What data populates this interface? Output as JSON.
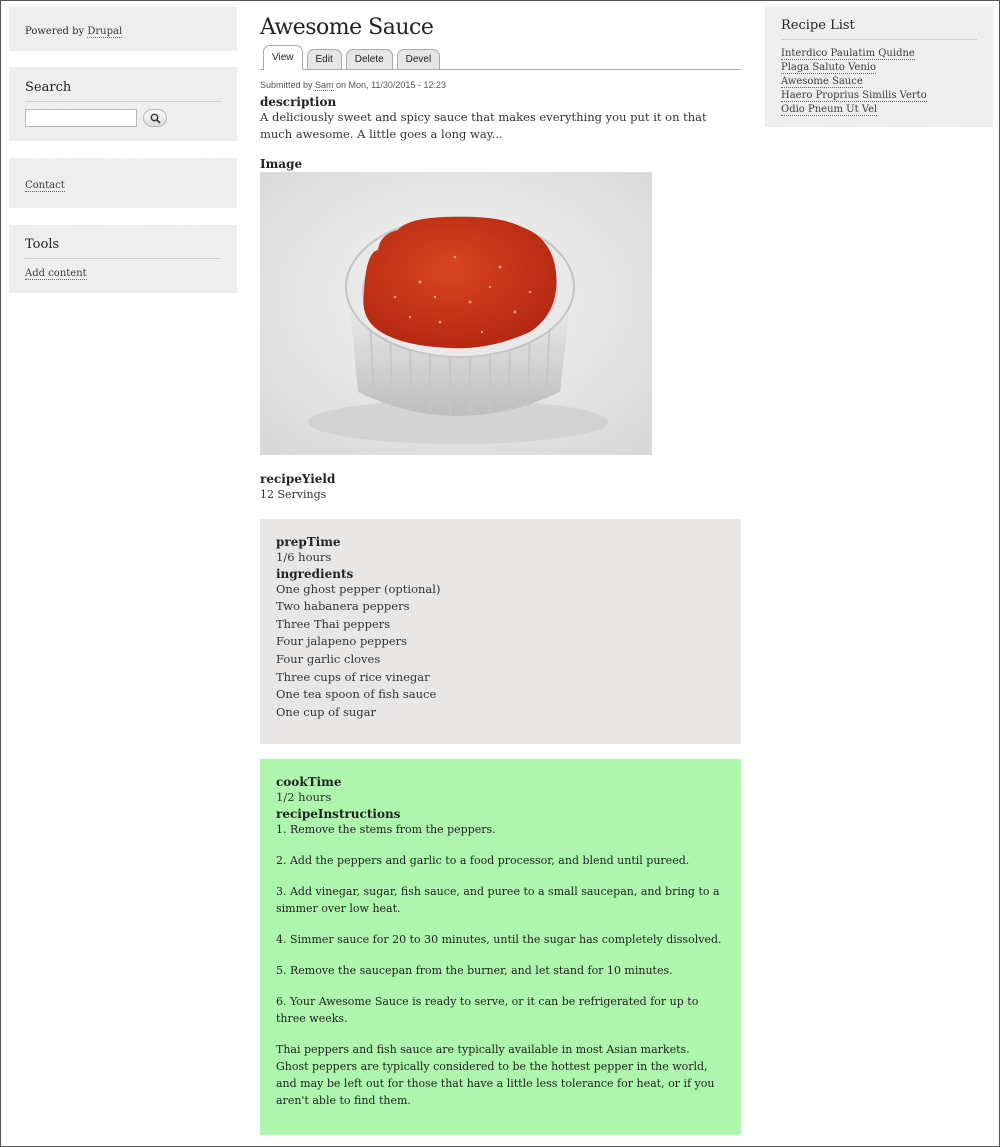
{
  "sidebar": {
    "powered_by_prefix": "Powered by ",
    "powered_by_link": "Drupal",
    "search": {
      "title": "Search",
      "value": "",
      "placeholder": ""
    },
    "contact_link": "Contact",
    "tools": {
      "title": "Tools",
      "add_content": "Add content"
    }
  },
  "recipe_list": {
    "title": "Recipe List",
    "items": [
      "Interdico Paulatim Quidne",
      "Plaga Saluto Venio",
      "Awesome Sauce",
      "Haero Proprius Similis Verto",
      "Odio Pneum Ut Vel"
    ]
  },
  "node": {
    "title": "Awesome Sauce",
    "tabs": [
      "View",
      "Edit",
      "Delete",
      "Devel"
    ],
    "submitted_prefix": "Submitted by ",
    "author": "Sam",
    "submitted_suffix": " on Mon, 11/30/2015 - 12:23",
    "description_label": "description",
    "description": "A deliciously sweet and spicy sauce that makes everything you put it on that much awesome. A little goes a long way...",
    "image_label": "Image",
    "yield_label": "recipeYield",
    "yield": "12 Servings",
    "prep_label": "prepTime",
    "prep": "1/6 hours",
    "ingredients_label": "ingredients",
    "ingredients": [
      "One ghost pepper (optional)",
      "Two habanera peppers",
      "Three Thai peppers",
      "Four jalapeno peppers",
      "Four garlic cloves",
      "Three cups of rice vinegar",
      "One tea spoon of fish sauce",
      "One cup of sugar"
    ],
    "cook_label": "cookTime",
    "cook": "1/2 hours",
    "instructions_label": "recipeInstructions",
    "instructions": [
      "1. Remove the stems from the peppers.",
      "2. Add the peppers and garlic to a food processor, and blend until pureed.",
      "3. Add vinegar, sugar, fish sauce, and puree to a small saucepan, and bring to a simmer over low heat.",
      "4. Simmer sauce for 20 to 30 minutes, until the sugar has completely dissolved.",
      "5. Remove the saucepan from the burner, and let stand for 10 minutes.",
      "6. Your Awesome Sauce is ready to serve, or it can be refrigerated for up to three weeks.",
      "Thai peppers and fish sauce are typically available in most Asian markets. Ghost peppers are typically considered to be the hottest pepper in the world, and may be left out for those that have a little less tolerance for heat, or if you aren't able to find them."
    ]
  },
  "colors": {
    "green_box": "#aef5ae",
    "grey_box": "#e8e7e6",
    "sidebar_block": "#ededed",
    "sauce": "#c8321c"
  }
}
